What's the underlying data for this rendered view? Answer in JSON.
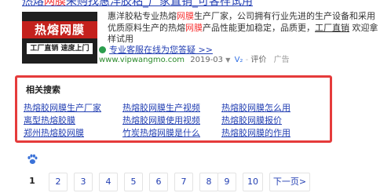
{
  "ad": {
    "title_pre": "热熔",
    "title_hl": "网膜",
    "title_post": "采购找惠洋胶粘_厂家直销_可客样试用",
    "image_title": "热熔网膜",
    "image_sub": "工厂直销  速度上门",
    "desc_pre": "惠洋胶粘专业热熔",
    "desc_hl1": "网膜",
    "desc_mid1": "生产厂家，公司拥有行业先进的生产设备和采用优质原料生产的热熔",
    "desc_hl2": "网膜",
    "desc_mid2": "产品性能更加稳定，品质更",
    "desc_u": "工厂直销",
    "desc_post": "欢迎拿样试用",
    "link_text": "专业客服在线为您答疑 >>",
    "url": "www.vipwangmo.com",
    "date": "2019-03",
    "v_badge": "V₂",
    "eval": "评价",
    "ad_tag": "广告"
  },
  "related": {
    "title": "相关搜索",
    "items": [
      "热熔胶网膜生产厂家",
      "热熔胶网膜生产视频",
      "热熔胶网膜怎么用",
      "离型热熔胶膜",
      "热熔胶网膜使用视频",
      "热熔胶网膜报价",
      "郑州热熔胶网膜",
      "竹炭热熔网膜是什么",
      "热熔胶网膜的作用"
    ]
  },
  "pagination": {
    "pages": [
      "1",
      "2",
      "3",
      "4",
      "5",
      "6",
      "7",
      "8",
      "9",
      "10"
    ],
    "current": "1",
    "next": "下一页>"
  }
}
